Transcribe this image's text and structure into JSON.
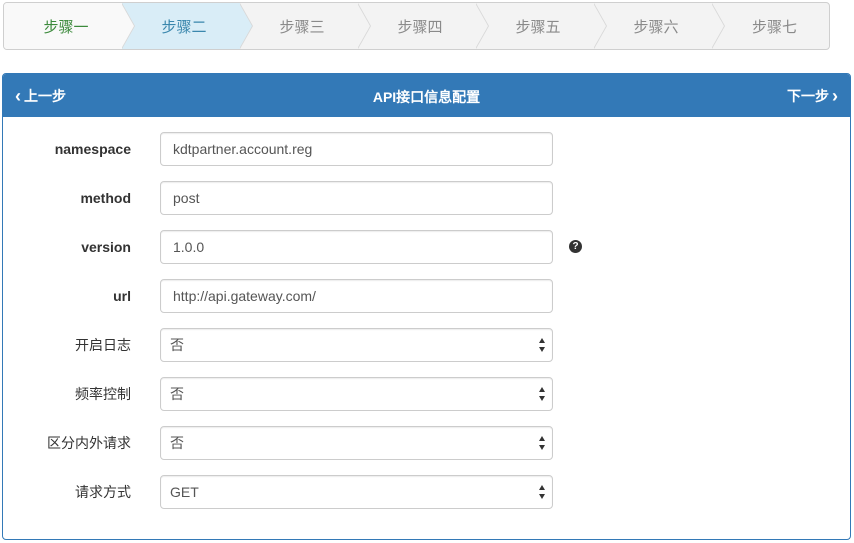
{
  "steps": [
    {
      "label": "步骤一",
      "state": "done"
    },
    {
      "label": "步骤二",
      "state": "active"
    },
    {
      "label": "步骤三",
      "state": "todo"
    },
    {
      "label": "步骤四",
      "state": "todo"
    },
    {
      "label": "步骤五",
      "state": "todo"
    },
    {
      "label": "步骤六",
      "state": "todo"
    },
    {
      "label": "步骤七",
      "state": "todo"
    }
  ],
  "panel": {
    "title": "API接口信息配置",
    "prev_label": "上一步",
    "next_label": "下一步",
    "prev_icon": "chevron-left-icon",
    "next_icon": "chevron-right-icon"
  },
  "form": {
    "namespace": {
      "label": "namespace",
      "value": "kdtpartner.account.reg"
    },
    "method": {
      "label": "method",
      "value": "post"
    },
    "version": {
      "label": "version",
      "value": "1.0.0",
      "help_icon": "question-circle-icon",
      "help_glyph": "?"
    },
    "url": {
      "label": "url",
      "value": "http://api.gateway.com/"
    },
    "log": {
      "label": "开启日志",
      "value": "否"
    },
    "rate": {
      "label": "频率控制",
      "value": "否"
    },
    "inout": {
      "label": "区分内外请求",
      "value": "否"
    },
    "reqmethod": {
      "label": "请求方式",
      "value": "GET"
    }
  },
  "colors": {
    "primary": "#3379b7",
    "step_done": "#3c8a3c",
    "step_active_bg": "#d9edf7",
    "step_active_text": "#3a87ad"
  }
}
